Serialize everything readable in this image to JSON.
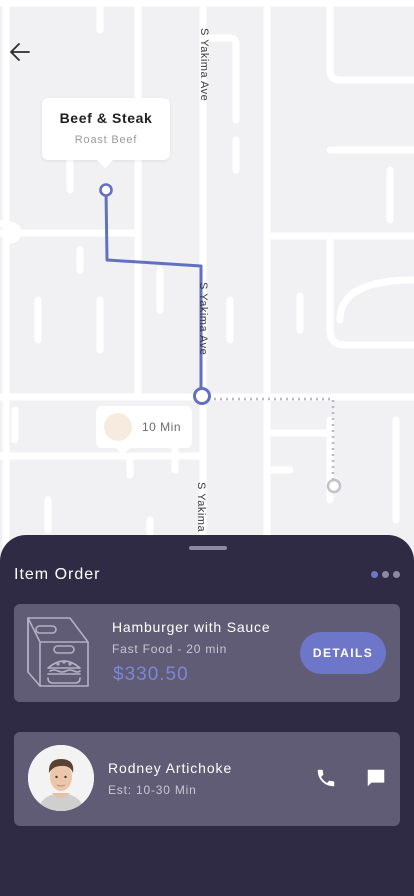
{
  "map": {
    "streets": [
      "S Yakima Ave",
      "S Yakima Ave",
      "S Yakima"
    ],
    "restaurant": {
      "name": "Beef & Steak",
      "dish": "Roast Beef"
    },
    "eta": "10 Min"
  },
  "order": {
    "title": "Item Order",
    "item_name": "Hamburger with Sauce",
    "item_meta": "Fast Food - 20 min",
    "price": "$330.50",
    "details_label": "DETAILS"
  },
  "driver": {
    "name": "Rodney Artichoke",
    "estimate": "Est: 10-30 Min"
  },
  "pager": {
    "count": 3,
    "active": 0
  },
  "colors": {
    "accent": "#6d76c8",
    "sheet": "#2f2b45",
    "card": "#605c75",
    "route": "#6270c2"
  },
  "icons": [
    "back-arrow-icon",
    "food-box-icon",
    "phone-icon",
    "chat-icon"
  ]
}
